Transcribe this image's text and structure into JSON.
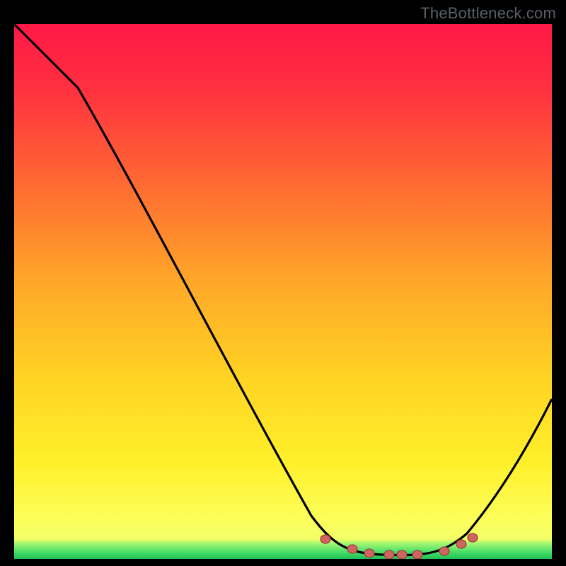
{
  "watermark": "TheBottleneck.com",
  "colors": {
    "gradient_top": "#ff1c46",
    "gradient_mid1": "#ff6a32",
    "gradient_mid2": "#ffe22d",
    "gradient_bottom": "#fffc66",
    "green_band_inner": "#1cc257",
    "curve_stroke": "#000000",
    "dot_fill": "#cf6560"
  },
  "chart_data": {
    "type": "line",
    "title": "",
    "xlabel": "",
    "ylabel": "",
    "xlim": [
      0,
      100
    ],
    "ylim": [
      0,
      100
    ],
    "x": [
      0,
      12,
      58,
      64,
      72,
      80,
      88,
      100
    ],
    "y": [
      100,
      88,
      10,
      3,
      0,
      0,
      3,
      30
    ],
    "optimum_region_x": [
      58,
      88
    ],
    "marker_points": [
      {
        "x": 58,
        "y": 3.0
      },
      {
        "x": 63,
        "y": 1.2
      },
      {
        "x": 66,
        "y": 0.6
      },
      {
        "x": 70,
        "y": 0.2
      },
      {
        "x": 72,
        "y": 0.2
      },
      {
        "x": 75,
        "y": 0.2
      },
      {
        "x": 80,
        "y": 0.6
      },
      {
        "x": 83,
        "y": 2.0
      },
      {
        "x": 85,
        "y": 3.0
      }
    ]
  }
}
